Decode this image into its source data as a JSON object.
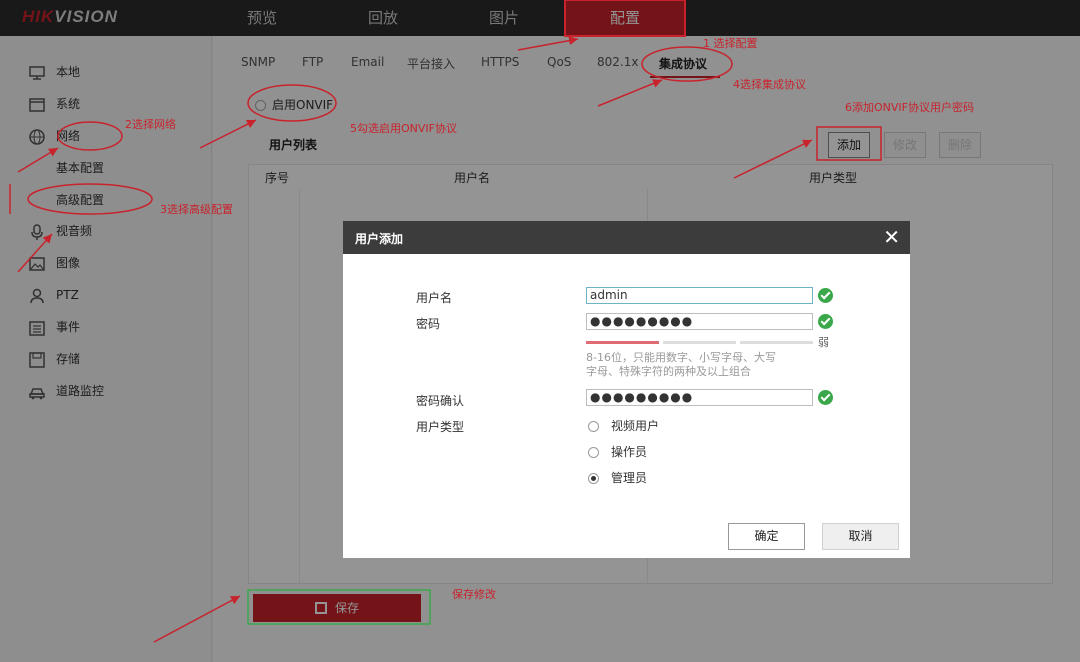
{
  "logo": {
    "part1": "HIK",
    "part2": "VISION"
  },
  "nav": [
    "预览",
    "回放",
    "图片",
    "配置"
  ],
  "sidebar": {
    "items": [
      {
        "label": "本地",
        "icon": "monitor-icon"
      },
      {
        "label": "系统",
        "icon": "window-icon"
      },
      {
        "label": "网络",
        "icon": "globe-icon"
      },
      {
        "label": "视音频",
        "icon": "microphone-icon"
      },
      {
        "label": "图像",
        "icon": "image-icon"
      },
      {
        "label": "PTZ",
        "icon": "person-icon"
      },
      {
        "label": "事件",
        "icon": "calendar-icon"
      },
      {
        "label": "存储",
        "icon": "disk-icon"
      },
      {
        "label": "道路监控",
        "icon": "car-icon"
      }
    ],
    "sub": [
      "基本配置",
      "高级配置"
    ]
  },
  "tabs": [
    "SNMP",
    "FTP",
    "Email",
    "平台接入",
    "HTTPS",
    "QoS",
    "802.1x",
    "集成协议"
  ],
  "onvif": {
    "label": "启用ONVIF"
  },
  "userlist": {
    "title": "用户列表",
    "buttons": [
      "添加",
      "修改",
      "删除"
    ],
    "headers": [
      "序号",
      "用户名",
      "用户类型"
    ]
  },
  "save": {
    "label": "保存"
  },
  "dialog": {
    "title": "用户添加",
    "close": "✕",
    "username_label": "用户名",
    "username_value": "admin",
    "password_label": "密码",
    "password_value": "●●●●●●●●●",
    "strength": "弱",
    "hint": "8-16位，只能用数字、小写字母、大写字母、特殊字符的两种及以上组合",
    "confirm_label": "密码确认",
    "confirm_value": "●●●●●●●●●",
    "usertype_label": "用户类型",
    "usertype_options": [
      "视频用户",
      "操作员",
      "管理员"
    ],
    "usertype_selected": "管理员",
    "ok": "确定",
    "cancel": "取消"
  },
  "annotations": {
    "a1": "1 选择配置",
    "a2": "2选择网络",
    "a3": "3选择高级配置",
    "a4": "4选择集成协议",
    "a5": "5勾选启用ONVIF协议",
    "a6": "6添加ONVIF协议用户密码",
    "a7": "保存修改"
  },
  "colors": {
    "brand": "#c8232c",
    "topbar": "#2b2b2b",
    "success": "#3aa84a",
    "dialog_header": "#3c3c3c"
  }
}
